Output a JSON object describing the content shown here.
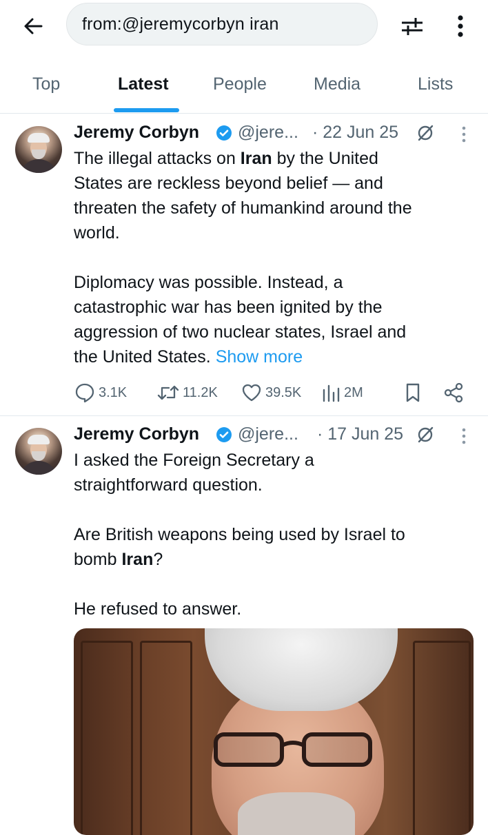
{
  "search": {
    "query": "from:@jeremycorbyn iran"
  },
  "tabs": [
    {
      "label": "Top"
    },
    {
      "label": "Latest"
    },
    {
      "label": "People"
    },
    {
      "label": "Media"
    },
    {
      "label": "Lists"
    }
  ],
  "colors": {
    "accent": "#1d9bf0",
    "text": "#0f1419",
    "secondary": "#536471"
  },
  "tweets": [
    {
      "name": "Jeremy Corbyn",
      "handle": "@jere...",
      "date": "· 22 Jun 25",
      "text": {
        "l1_a": "The illegal attacks on ",
        "l1_b": "Iran",
        "l1_c": " by the United",
        "l2": "States are reckless beyond belief — and",
        "l3": "threaten the safety of humankind around the",
        "l4": "world.",
        "l6": "Diplomacy was possible. Instead, a",
        "l7": "catastrophic war has been ignited by the",
        "l8": "aggression of two nuclear states, Israel and",
        "l9": "the United States.",
        "show_more": "Show more"
      },
      "stats": {
        "replies": "3.1K",
        "reposts": "11.2K",
        "likes": "39.5K",
        "views": "2M"
      }
    },
    {
      "name": "Jeremy Corbyn",
      "handle": "@jere...",
      "date": "· 17 Jun 25",
      "text": {
        "l1": "I asked the Foreign Secretary a",
        "l2": "straightforward question.",
        "l4": "Are British weapons being used by Israel to",
        "l5_a": "bomb ",
        "l5_b": "Iran",
        "l5_c": "?",
        "l7": "He refused to answer."
      }
    }
  ]
}
